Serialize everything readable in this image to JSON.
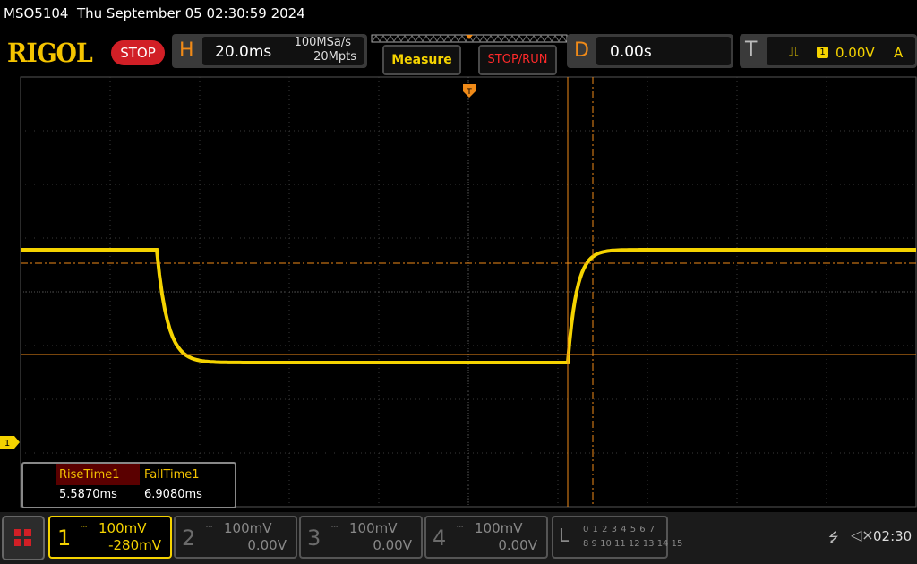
{
  "header": {
    "device_title": "MSO5104  Thu September 05 02:30:59 2024"
  },
  "logo": {
    "text": "RIGOL"
  },
  "run_status": "STOP",
  "horizontal": {
    "letter": "H",
    "scale": "20.0ms",
    "sample_rate": "100MSa/s",
    "memory_depth": "20Mpts"
  },
  "buttons": {
    "measure": "Measure",
    "stop_run": "STOP/RUN"
  },
  "delay": {
    "letter": "D",
    "value": "0.00s"
  },
  "trigger": {
    "letter": "T",
    "edge_icon": "rising-edge-icon",
    "source": "1",
    "level": "0.00V",
    "mode": "A"
  },
  "measurements": {
    "rise_label": "RiseTime1",
    "rise_value": "5.5870ms",
    "fall_label": "FallTime1",
    "fall_value": "6.9080ms"
  },
  "channels": [
    {
      "num": "1",
      "scale": "100mV",
      "offset": "-280mV",
      "color": "#f5d300",
      "active": true
    },
    {
      "num": "2",
      "scale": "100mV",
      "offset": "0.00V",
      "active": false
    },
    {
      "num": "3",
      "scale": "100mV",
      "offset": "0.00V",
      "active": false
    },
    {
      "num": "4",
      "scale": "100mV",
      "offset": "0.00V",
      "active": false
    }
  ],
  "logic": {
    "letter": "L",
    "row1": "0 1 2 3  4 5 6 7",
    "row2": "8 9 10 11 12 13 14 15"
  },
  "clock": "02:30",
  "marker_labels": {
    "ch1": "1",
    "trigger": "T"
  },
  "colors": {
    "trace": "#f5d300",
    "cursor": "#f08a18",
    "grid": "#404040"
  }
}
